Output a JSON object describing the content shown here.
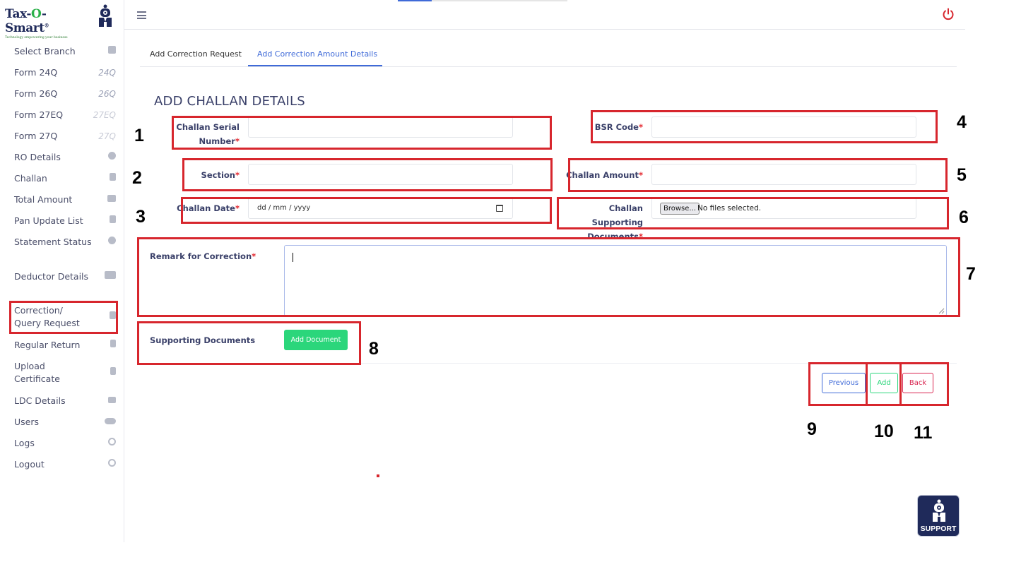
{
  "brand": {
    "name_part1": "Tax-",
    "name_o": "O",
    "name_part2": "-Smart",
    "registered": "®",
    "tagline": "Technology empowering your business"
  },
  "sidebar": {
    "items": [
      {
        "label": "Select Branch",
        "icon": "clipboard-icon"
      },
      {
        "label": "Form 24Q",
        "icon_text": "24Q"
      },
      {
        "label": "Form 26Q",
        "icon_text": "26Q"
      },
      {
        "label": "Form 27EQ",
        "icon_text": "27EQ"
      },
      {
        "label": "Form 27Q",
        "icon_text": "27Q"
      },
      {
        "label": "RO Details",
        "icon": "info-icon"
      },
      {
        "label": "Challan",
        "icon": "document-icon"
      },
      {
        "label": "Total Amount",
        "icon": "wallet-icon"
      },
      {
        "label": "Pan Update List",
        "icon": "clipboard-list-icon"
      },
      {
        "label": "Statement Status",
        "icon": "clock-icon"
      },
      {
        "label": "Deductor Details",
        "icon": "card-icon"
      },
      {
        "label": "Correction/ Query Request",
        "icon": "clipboard-alert-icon"
      },
      {
        "label": "Regular Return",
        "icon": "file-icon"
      },
      {
        "label": "Upload Certificate",
        "icon": "file-upload-icon"
      },
      {
        "label": "LDC Details",
        "icon": "monitor-icon"
      },
      {
        "label": "Users",
        "icon": "users-icon"
      },
      {
        "label": "Logs",
        "icon": "history-icon"
      },
      {
        "label": "Logout",
        "icon": "power-icon"
      }
    ]
  },
  "tabs": [
    {
      "label": "Add Correction Request",
      "active": false
    },
    {
      "label": "Add Correction Amount Details",
      "active": true
    }
  ],
  "page_title": "ADD CHALLAN DETAILS",
  "form": {
    "challan_serial_line1": "Challan Serial",
    "challan_serial_line2": "Number",
    "section": "Section",
    "challan_date": "Challan Date",
    "date_placeholder": "dd / mm / yyyy",
    "bsr_code": "BSR Code",
    "challan_amount": "Challan Amount",
    "supporting_docs_line1": "Challan Supporting",
    "supporting_docs_line2": "Documents",
    "browse_label": "Browse...",
    "no_file_text": "No files selected.",
    "remark": "Remark for Correction",
    "supporting_documents": "Supporting Documents",
    "required_mark": "*"
  },
  "buttons": {
    "add_document": "Add Document",
    "previous": "Previous",
    "add": "Add",
    "back": "Back"
  },
  "annotations": [
    "1",
    "2",
    "3",
    "4",
    "5",
    "6",
    "7",
    "8",
    "9",
    "10",
    "11"
  ],
  "support": {
    "label": "SUPPORT"
  },
  "colors": {
    "accent": "#3f6ad8",
    "success": "#2bd67b",
    "danger": "#d92550",
    "annotation_red": "#d7262d",
    "navy": "#1f2a5a"
  }
}
